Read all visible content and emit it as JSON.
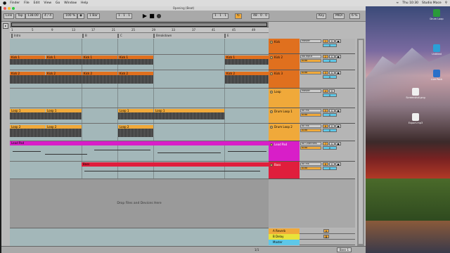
{
  "menubar": {
    "apple": "",
    "items": [
      "Finder",
      "File",
      "Edit",
      "View",
      "Go",
      "Window",
      "Help"
    ],
    "right": [
      "Thu 10:30",
      "Studio Mace"
    ]
  },
  "window": {
    "title": "Opening (Beat)"
  },
  "control_bar": {
    "link": "Link",
    "tap": "Tap",
    "tempo": "138.00",
    "time_sig": "4 / 4",
    "zoom": "100 %",
    "quant": "1 Bar",
    "position": "1 . 1 . 1",
    "loop_start": "1 . 1 . 1",
    "loop_len": "48 . 0 . 0",
    "key_label": "Key",
    "midi_label": "MIDI",
    "cpu": "6 %"
  },
  "ruler": {
    "marks": [
      "1",
      "5",
      "9",
      "13",
      "17",
      "21",
      "25",
      "29",
      "33",
      "37",
      "41",
      "45",
      "49"
    ]
  },
  "locators": [
    {
      "label": "Intro"
    },
    {
      "label": "B"
    },
    {
      "label": "C"
    },
    {
      "label": "Breakdown"
    },
    {
      "label": "E"
    }
  ],
  "tracks": [
    {
      "name": "Kick",
      "color": "#e0701e",
      "input": "Master",
      "number": "1",
      "volume": "0"
    },
    {
      "name": "Kick 2",
      "color": "#e0701e",
      "input": "No Input",
      "number": "2",
      "volume": "0"
    },
    {
      "name": "Kick 3",
      "color": "#e0701e",
      "input": "Auto",
      "number": "3",
      "volume": "0"
    },
    {
      "name": "Loop",
      "color": "#f0a93a",
      "input": "Master",
      "number": "4",
      "volume": "0"
    },
    {
      "name": "Drum Loop 1",
      "color": "#f0a93a",
      "input": "All Ins",
      "number": "5",
      "volume": "0"
    },
    {
      "name": "Drum Loop 2",
      "color": "#f0a93a",
      "input": "All Ins",
      "number": "6",
      "volume": "0"
    },
    {
      "name": "Lead Pad",
      "color": "#d81ec8",
      "input": "All Channels",
      "number": "7",
      "volume": "0"
    },
    {
      "name": "Bass",
      "color": "#e01e3c",
      "input": "All Ins",
      "number": "8",
      "volume": "0"
    }
  ],
  "clips": {
    "kick1": "Kick 1",
    "kick2": "Kick 2",
    "loop1": "Loop 1",
    "loop2": "Loop 2",
    "lead": "Lead Pad",
    "bass": "Bass"
  },
  "drop_zone": "Drop Files and Devices Here",
  "returns": [
    {
      "name": "A Reverb",
      "color": "#f0a93a",
      "letter": "A"
    },
    {
      "name": "B Delay",
      "color": "#e8e23a",
      "letter": "B"
    },
    {
      "name": "Master",
      "color": "#5ec8e8",
      "letter": ""
    }
  ],
  "io_labels": {
    "in": "In",
    "auto": "Auto",
    "off": "Off",
    "sends": "S",
    "solo": "S",
    "mute": "M"
  },
  "bottom": {
    "track_label": "Bass 1",
    "page": "1/1"
  },
  "desktop_icons": [
    {
      "label": "Drum Loop",
      "color": "#2a9a3a"
    },
    {
      "label": "Untitled",
      "color": "#2aa0d8"
    },
    {
      "label": "Live Pack",
      "color": "#2a70c8"
    },
    {
      "label": "Screenshot.png",
      "color": "#f0f0f0"
    },
    {
      "label": "Export.mp3",
      "color": "#f0f0f0"
    }
  ]
}
